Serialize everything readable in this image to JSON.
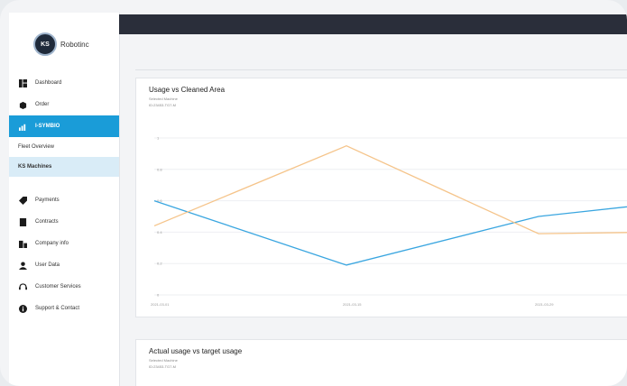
{
  "brand": {
    "name": "Robotinc"
  },
  "nav": {
    "items": [
      {
        "label": "Dashboard"
      },
      {
        "label": "Order"
      },
      {
        "label": "I-SYMBIO"
      }
    ],
    "sub_items": [
      {
        "label": "Fleet Overview"
      },
      {
        "label": "KS Machines"
      }
    ],
    "items2": [
      {
        "label": "Payments"
      },
      {
        "label": "Contracts"
      },
      {
        "label": "Company info"
      },
      {
        "label": "User Data"
      },
      {
        "label": "Customer Services"
      },
      {
        "label": "Support & Contact"
      }
    ]
  },
  "card1": {
    "title": "Usage vs Cleaned Area",
    "sub1": "Selected Machine",
    "sub2": "ID:23453-TG7-M"
  },
  "card2": {
    "title": "Actual usage vs target usage",
    "sub1": "Selected Machine",
    "sub2": "ID:23453-TG7-M"
  },
  "chart_data": {
    "type": "line",
    "title": "Usage vs Cleaned Area",
    "categories": [
      "2021-03-01",
      "2021-03-15",
      "2021-03-29"
    ],
    "y_ticks": [
      "0",
      "0.2",
      "0.4",
      "0.6",
      "0.8",
      "1"
    ],
    "ylim": [
      0,
      1
    ],
    "series": [
      {
        "color": "#3aa6e0",
        "x": [
          0,
          1,
          2,
          2.6
        ],
        "values": [
          0.6,
          0.19,
          0.5,
          0.58
        ]
      },
      {
        "color": "#f5c48a",
        "x": [
          0,
          1,
          2,
          2.6
        ],
        "values": [
          0.44,
          0.95,
          0.39,
          0.4
        ]
      }
    ]
  }
}
